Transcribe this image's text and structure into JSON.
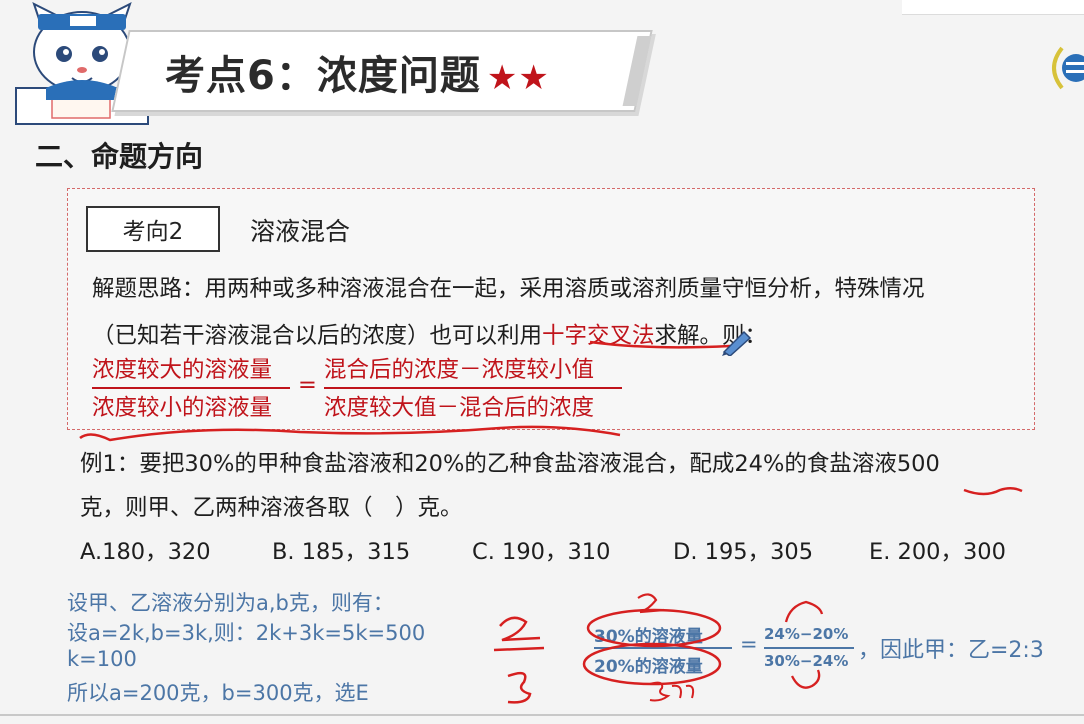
{
  "title": {
    "text": "考点6：浓度问题",
    "stars": "★★"
  },
  "section_heading": "二、命题方向",
  "box": {
    "tag": "考向2",
    "topic": "溶液混合",
    "line1": "解题思路：用两种或多种溶液混合在一起，采用溶质或溶剂质量守恒分析，特殊情况",
    "line2_pre": "（已知若干溶液混合以后的浓度）也可以利用",
    "line2_highlight": "十字交叉法",
    "line2_post": "求解。则：",
    "formula": {
      "left_num": "浓度较大的溶液量",
      "left_den": "浓度较小的溶液量",
      "equals": "=",
      "right_num": "混合后的浓度－浓度较小值",
      "right_den": "浓度较大值－混合后的浓度"
    }
  },
  "example": {
    "line1": "例1：要把30%的甲种食盐溶液和20%的乙种食盐溶液混合，配成24%的食盐溶液500",
    "line2": "克，则甲、乙两种溶液各取（　）克。",
    "options": [
      "A.180，320",
      "B. 185，315",
      "C. 190，310",
      "D. 195，305",
      "E. 200，300"
    ]
  },
  "solution": {
    "lines": [
      "设甲、乙溶液分别为a,b克，则有：",
      "设a=2k,b=3k,则：2k+3k=5k=500",
      "k=100",
      "所以a=200克，b=300克，选E"
    ],
    "fraction_left_num": "30%的溶液量",
    "fraction_left_den": "20%的溶液量",
    "equals": "=",
    "fraction_right_num": "24%−20%",
    "fraction_right_den": "30%−24%",
    "conclusion": "，因此甲：乙=2:3"
  },
  "colors": {
    "accent_red": "#c0141b",
    "solution_blue": "#4c76a6",
    "box_border": "#d46a6a"
  },
  "icons": [
    "mascot-cat-icon",
    "pen-cursor-icon",
    "logo-mark-icon"
  ]
}
